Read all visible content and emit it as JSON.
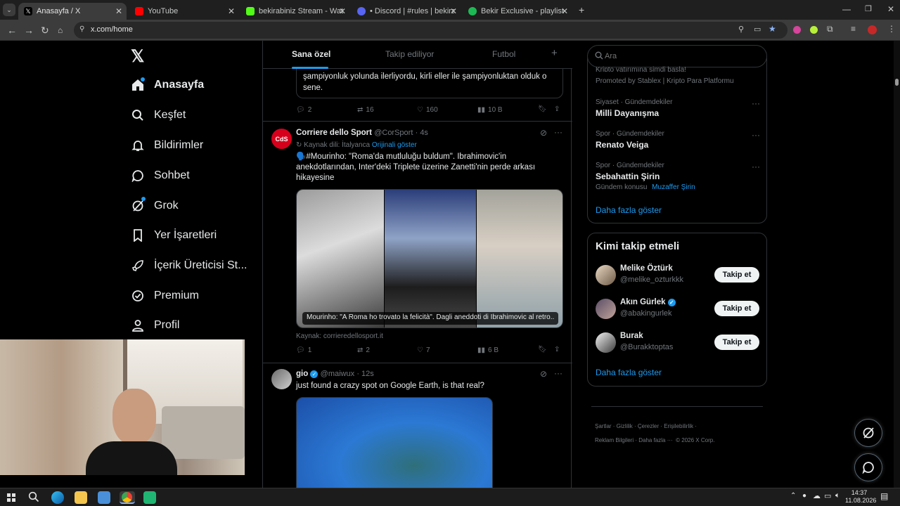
{
  "browser": {
    "tabs": [
      {
        "title": "Anasayfa / X",
        "color": "#000000",
        "active": true
      },
      {
        "title": "YouTube",
        "color": "#ff0000",
        "active": false
      },
      {
        "title": "bekirabiniz Stream - Watch Live",
        "color": "#53fc18",
        "active": false
      },
      {
        "title": "• Discord | #rules | bekirabiniz",
        "color": "#5865f2",
        "active": false
      },
      {
        "title": "Bekir Exclusive - playlist by Bek",
        "color": "#1db954",
        "active": false
      }
    ],
    "new_tab": "+",
    "url": "x.com/home"
  },
  "nav": {
    "items": [
      {
        "label": "Anasayfa",
        "icon": "home-icon"
      },
      {
        "label": "Keşfet",
        "icon": "search-icon"
      },
      {
        "label": "Bildirimler",
        "icon": "bell-icon"
      },
      {
        "label": "Sohbet",
        "icon": "chat-icon"
      },
      {
        "label": "Grok",
        "icon": "grok-icon"
      },
      {
        "label": "Yer İşaretleri",
        "icon": "bookmark-icon"
      },
      {
        "label": "İçerik Üreticisi St...",
        "icon": "rocket-icon"
      },
      {
        "label": "Premium",
        "icon": "verified-icon"
      },
      {
        "label": "Profil",
        "icon": "user-icon"
      }
    ]
  },
  "feed": {
    "tabs": [
      "Sana özel",
      "Takip ediliyor",
      "Futbol"
    ],
    "add_tab": "+",
    "quoted_partial": {
      "text_line1": "şampiyonluk yolunda ilerliyordu, kirli eller ile şampiyonluktan olduk o",
      "text_line2": "sene.",
      "stats": {
        "replies": "2",
        "reposts": "16",
        "likes": "160",
        "views": "10 B"
      }
    },
    "post1": {
      "author": "Corriere dello Sport",
      "handle": "@CorSport",
      "time": "· 4s",
      "translation_note": "Kaynak dili: İtalyanca",
      "show_original": "Orijinali göster",
      "text": "🗣️#Mourinho: \"Roma'da mutluluğu buldum\". Ibrahimovic'in anekdotlarından, Inter'deki Triplete üzerine Zanetti'nin perde arkası hikayesine",
      "image_caption": "Mourinho: \"A Roma ho trovato la felicità\". Dagli aneddoti di Ibrahimovic al retro...",
      "link_source": "Kaynak: corrieredellosport.it",
      "stats": {
        "replies": "1",
        "reposts": "2",
        "likes": "7",
        "views": "6 B"
      }
    },
    "post2": {
      "author": "gio",
      "handle": "@maiwux",
      "time": "· 12s",
      "text": "just found a crazy spot on Google Earth, is that real?"
    }
  },
  "right": {
    "search_placeholder": "Ara",
    "trends_partial": {
      "top_line": "Kripto yatırımına şimdi başla!",
      "promoted": "Promoted by Stablex | Kripto Para Platformu"
    },
    "trends": [
      {
        "category": "Siyaset · Gündemdekiler",
        "name": "Milli Dayanışma"
      },
      {
        "category": "Spor · Gündemdekiler",
        "name": "Renato Veiga"
      },
      {
        "category": "Spor · Gündemdekiler",
        "name": "Sebahattin Şirin",
        "topic_label": "Gündem konusu",
        "topic": "Muzaffer Şirin"
      }
    ],
    "show_more": "Daha fazla göster",
    "who_to_follow": {
      "title": "Kimi takip etmeli",
      "users": [
        {
          "name": "Melike Öztürk",
          "handle": "@melike_ozturkkk",
          "verified": false
        },
        {
          "name": "Akın Gürlek",
          "handle": "@abakingurlek",
          "verified": true
        },
        {
          "name": "Burak",
          "handle": "@Burakktoptas",
          "verified": false
        }
      ],
      "follow_label": "Takip et",
      "show_more": "Daha fazla göster"
    },
    "footer": {
      "links": [
        "Şartlar",
        "Gizlilik",
        "Çerezler",
        "Erişilebilirlik",
        "Reklam Bilgileri",
        "Daha fazla ···"
      ],
      "copyright": "© 2026 X Corp."
    }
  },
  "taskbar": {
    "time": "14:37",
    "date": "11.08.2026"
  },
  "colors": {
    "accent": "#1d9bf0",
    "bg": "#000000",
    "border": "#2f3336",
    "muted": "#71767b"
  }
}
